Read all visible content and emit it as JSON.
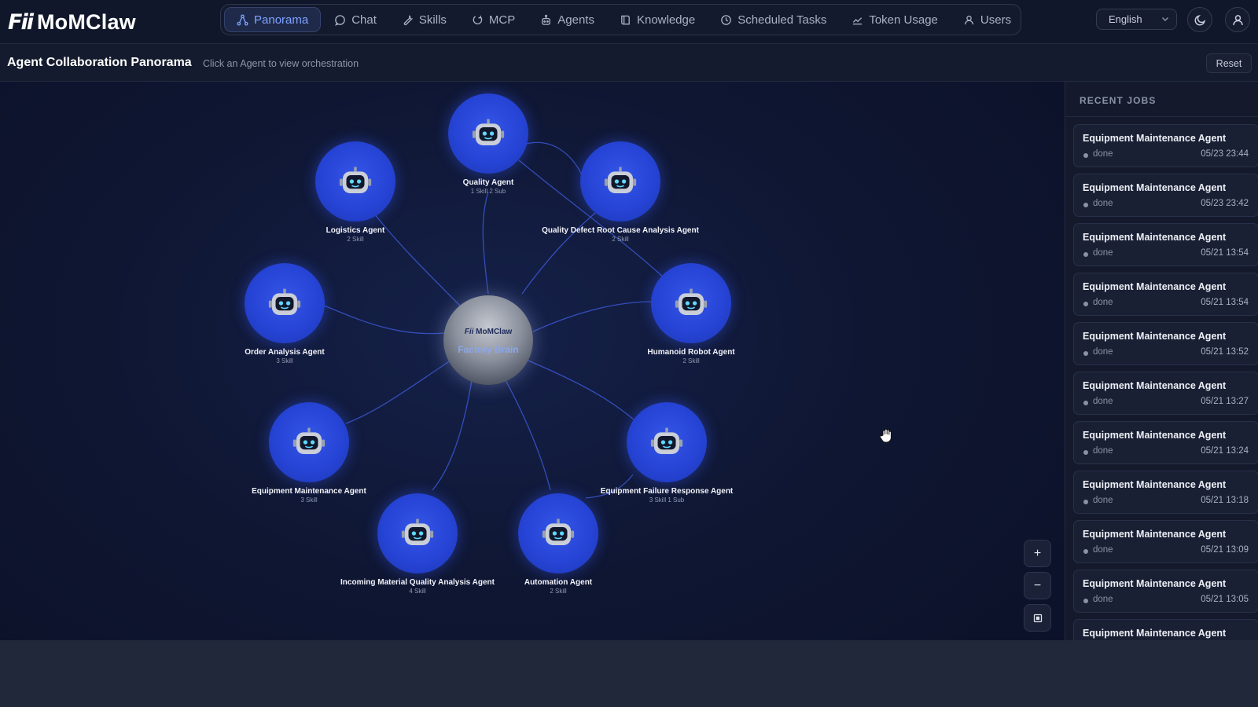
{
  "app": {
    "logo_mark": "Fii",
    "name": "MoMClaw"
  },
  "nav": {
    "items": [
      {
        "label": "Panorama",
        "icon": "network-icon",
        "active": true
      },
      {
        "label": "Chat",
        "icon": "chat-bubble-icon"
      },
      {
        "label": "Skills",
        "icon": "wrench-icon"
      },
      {
        "label": "MCP",
        "icon": "plug-icon"
      },
      {
        "label": "Agents",
        "icon": "robot-icon"
      },
      {
        "label": "Knowledge",
        "icon": "book-icon"
      },
      {
        "label": "Scheduled Tasks",
        "icon": "clock-icon"
      },
      {
        "label": "Token Usage",
        "icon": "chart-line-icon"
      },
      {
        "label": "Users",
        "icon": "user-icon"
      }
    ],
    "language": "English"
  },
  "header": {
    "title": "Agent Collaboration Panorama",
    "hint": "Click an Agent to view orchestration",
    "reset_label": "Reset"
  },
  "hub": {
    "logo": "MoMClaw",
    "logo_mark": "Fii",
    "name": "Factory Brain"
  },
  "agents": [
    {
      "name": "Quality Agent",
      "meta": "1 Skill 2 Sub"
    },
    {
      "name": "Logistics Agent",
      "meta": "2 Skill"
    },
    {
      "name": "Quality Defect Root Cause Analysis Agent",
      "meta": "2 Skill"
    },
    {
      "name": "Order Analysis Agent",
      "meta": "3 Skill"
    },
    {
      "name": "Humanoid Robot Agent",
      "meta": "2 Skill"
    },
    {
      "name": "Equipment Maintenance Agent",
      "meta": "3 Skill"
    },
    {
      "name": "Equipment Failure Response Agent",
      "meta": "3 Skill 1 Sub"
    },
    {
      "name": "Incoming Material Quality Analysis Agent",
      "meta": "4 Skill"
    },
    {
      "name": "Automation Agent",
      "meta": "2 Skill"
    }
  ],
  "zoom_controls": {
    "zoom_in": "+",
    "zoom_out": "−"
  },
  "recent_jobs": {
    "title": "RECENT JOBS",
    "items": [
      {
        "name": "Equipment Maintenance Agent",
        "status": "done",
        "time": "05/23 23:44"
      },
      {
        "name": "Equipment Maintenance Agent",
        "status": "done",
        "time": "05/23 23:42"
      },
      {
        "name": "Equipment Maintenance Agent",
        "status": "done",
        "time": "05/21 13:54"
      },
      {
        "name": "Equipment Maintenance Agent",
        "status": "done",
        "time": "05/21 13:54"
      },
      {
        "name": "Equipment Maintenance Agent",
        "status": "done",
        "time": "05/21 13:52"
      },
      {
        "name": "Equipment Maintenance Agent",
        "status": "done",
        "time": "05/21 13:27"
      },
      {
        "name": "Equipment Maintenance Agent",
        "status": "done",
        "time": "05/21 13:24"
      },
      {
        "name": "Equipment Maintenance Agent",
        "status": "done",
        "time": "05/21 13:18"
      },
      {
        "name": "Equipment Maintenance Agent",
        "status": "done",
        "time": "05/21 13:09"
      },
      {
        "name": "Equipment Maintenance Agent",
        "status": "done",
        "time": "05/21 13:05"
      },
      {
        "name": "Equipment Maintenance Agent",
        "status": "",
        "time": ""
      }
    ]
  },
  "colors": {
    "accent": "#7ea3ff",
    "agent_node": "#2644d6",
    "edge": "#3e5bd8",
    "canvas_bg": "#0f1632"
  }
}
